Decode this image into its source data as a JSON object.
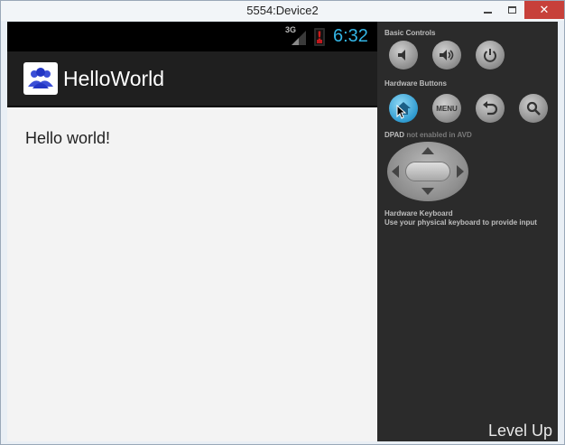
{
  "window": {
    "title": "5554:Device2"
  },
  "device": {
    "status_bar": {
      "network": "3G",
      "time": "6:32"
    },
    "app": {
      "title": "HelloWorld",
      "content": "Hello world!"
    }
  },
  "controls": {
    "basic_controls_label": "Basic Controls",
    "basic_controls": [
      {
        "name": "volume-down-icon"
      },
      {
        "name": "volume-up-icon"
      },
      {
        "name": "power-icon"
      }
    ],
    "hardware_buttons_label": "Hardware Buttons",
    "hardware_buttons": [
      {
        "name": "home-icon",
        "active": true
      },
      {
        "name": "menu",
        "label": "MENU"
      },
      {
        "name": "back-icon"
      },
      {
        "name": "search-icon"
      }
    ],
    "dpad_label": "DPAD",
    "dpad_note": "not enabled in AVD",
    "keyboard_label": "Hardware Keyboard",
    "keyboard_note": "Use your physical keyboard to provide input"
  },
  "watermark": "Level Up",
  "colors": {
    "clock": "#33b5e5",
    "active_button": "#2f9bd0",
    "panel": "#2b2b2b",
    "action_bar": "#1f1f1f"
  }
}
